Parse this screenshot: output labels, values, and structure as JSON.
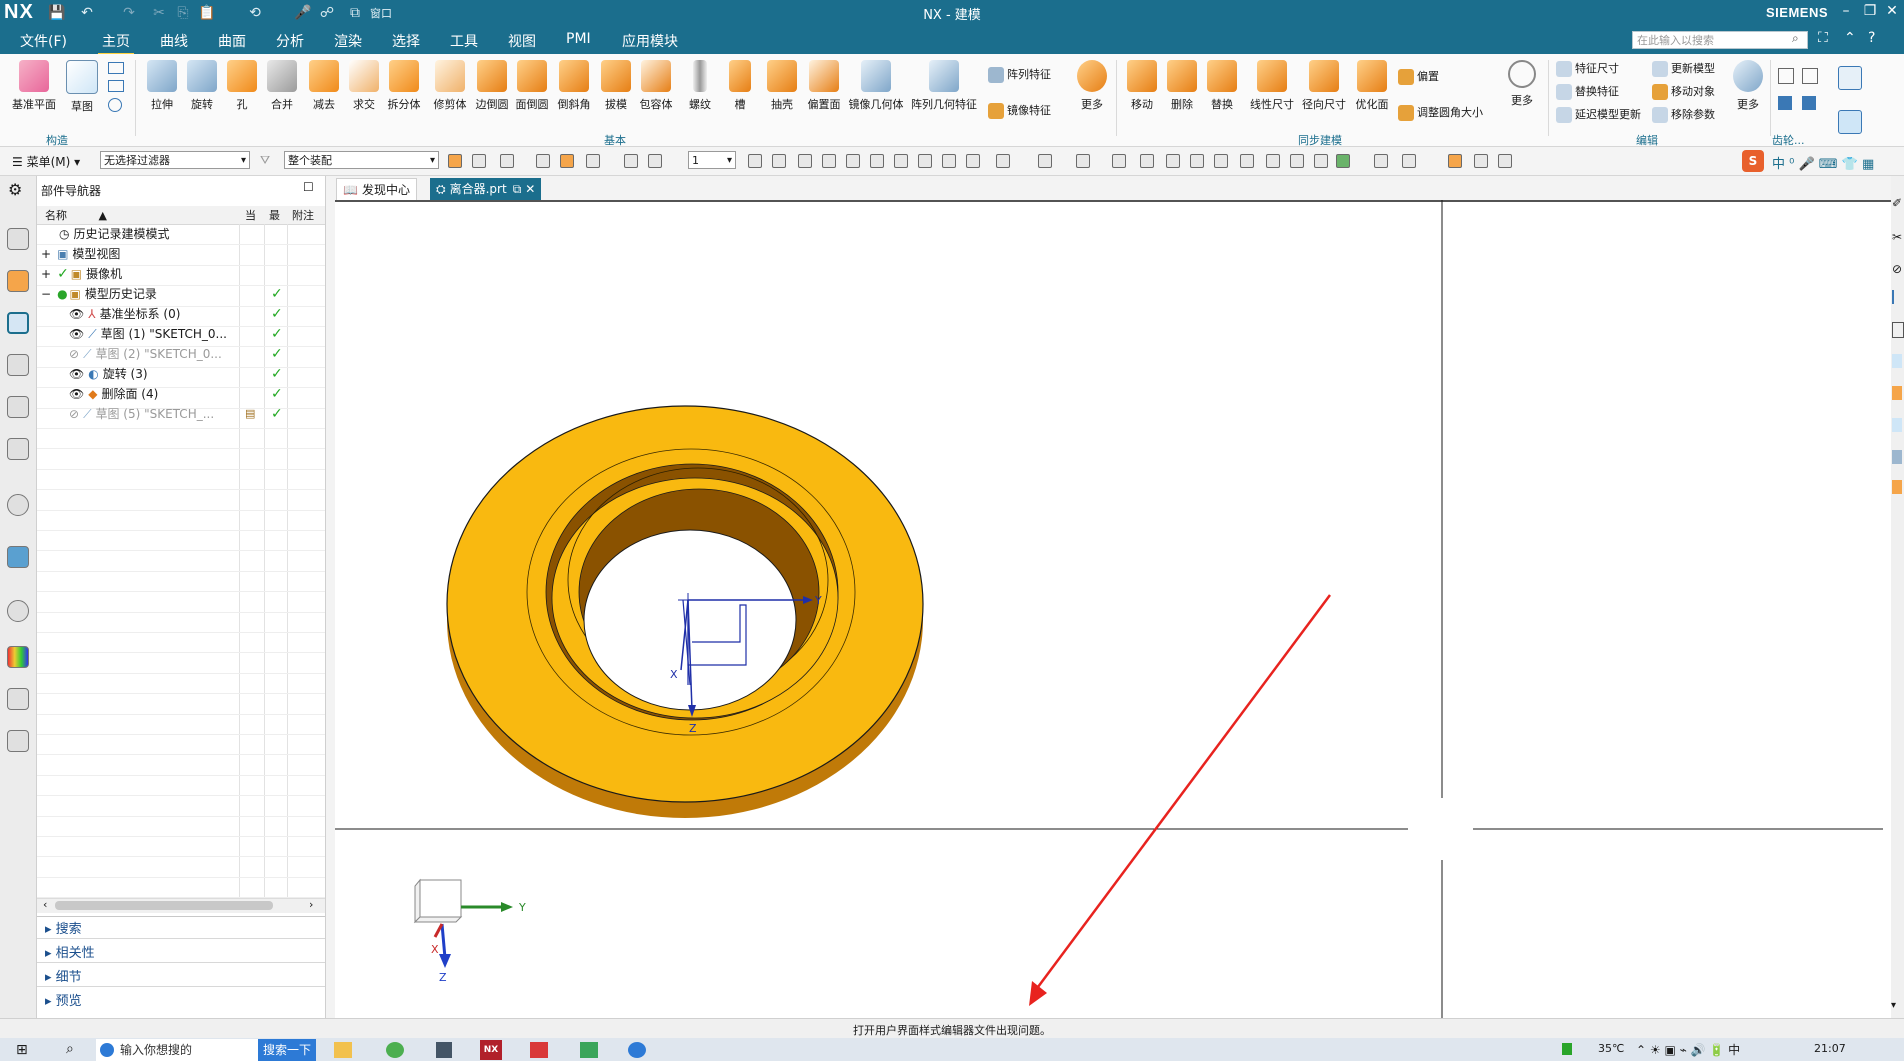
{
  "titlebar": {
    "app_logo": "NX",
    "window_title": "NX - 建模",
    "window_menu": "窗口",
    "brand": "SIEMENS",
    "controls": [
      "minimize-icon",
      "restore-icon",
      "collapse-icon",
      "help-icon"
    ]
  },
  "menu_tabs": [
    "文件(F)",
    "主页",
    "曲线",
    "曲面",
    "分析",
    "渲染",
    "选择",
    "工具",
    "视图",
    "PMI",
    "应用模块"
  ],
  "active_tab": "主页",
  "search": {
    "placeholder": "在此输入以搜索"
  },
  "ribbon": {
    "construct": {
      "group_label": "构造",
      "items": [
        "基准平面",
        "草图"
      ]
    },
    "basic": {
      "group_label": "基本",
      "items": [
        "拉伸",
        "旋转",
        "孔",
        "合并",
        "减去",
        "求交",
        "拆分体",
        "修剪体",
        "边倒圆",
        "面倒圆",
        "倒斜角",
        "拔模",
        "包容体",
        "螺纹",
        "槽",
        "抽壳",
        "偏置面",
        "镜像几何体",
        "阵列几何特征"
      ],
      "small_items": [
        "阵列特征",
        "镜像特征"
      ],
      "more": "更多"
    },
    "sync": {
      "group_label": "同步建模",
      "items": [
        "移动",
        "删除",
        "替换",
        "线性尺寸",
        "径向尺寸",
        "优化面"
      ],
      "small_items": [
        "偏置",
        "调整圆角大小"
      ],
      "more": "更多"
    },
    "edit": {
      "group_label": "编辑",
      "small_items": [
        "特征尺寸",
        "替换特征",
        "延迟模型更新",
        "更新模型",
        "移动对象",
        "移除参数"
      ],
      "more": "更多"
    },
    "gear": {
      "group_label": "齿轮..."
    }
  },
  "toolbar": {
    "menu_label": "菜单(M)",
    "filter_value": "无选择过滤器",
    "scope_value": "整个装配",
    "layer_value": "1"
  },
  "navigator": {
    "title": "部件导航器",
    "columns": [
      "名称",
      "当",
      "最",
      "附注"
    ],
    "rows": [
      {
        "label": "历史记录建模模式",
        "dim": false,
        "check": false
      },
      {
        "label": "模型视图",
        "dim": false,
        "check": false
      },
      {
        "label": "摄像机",
        "dim": false,
        "check": false
      },
      {
        "label": "模型历史记录",
        "dim": false,
        "check": true
      },
      {
        "label": "基准坐标系 (0)",
        "dim": false,
        "check": true
      },
      {
        "label": "草图 (1) \"SKETCH_0...",
        "dim": false,
        "check": true
      },
      {
        "label": "草图 (2) \"SKETCH_0...",
        "dim": true,
        "check": true
      },
      {
        "label": "旋转 (3)",
        "dim": false,
        "check": true
      },
      {
        "label": "删除面 (4)",
        "dim": false,
        "check": true
      },
      {
        "label": "草图 (5) \"SKETCH_...",
        "dim": true,
        "check": true
      }
    ],
    "sections": [
      "搜索",
      "相关性",
      "细节",
      "预览"
    ]
  },
  "doc_tabs": [
    {
      "label": "发现中心",
      "active": false
    },
    {
      "label": "离合器.prt",
      "active": true
    }
  ],
  "viewport": {
    "model_color": "#f9b910",
    "model_shadow_color": "#8a5200",
    "axis_labels": {
      "x": "X",
      "y": "Y",
      "z": "Z"
    }
  },
  "status": {
    "message": "打开用户界面样式编辑器文件出现问题。"
  },
  "taskbar": {
    "search_placeholder": "输入你想搜的",
    "search_button": "搜索一下",
    "temperature": "35℃",
    "time": "21:07"
  },
  "accent_color": "#1b6e8d"
}
